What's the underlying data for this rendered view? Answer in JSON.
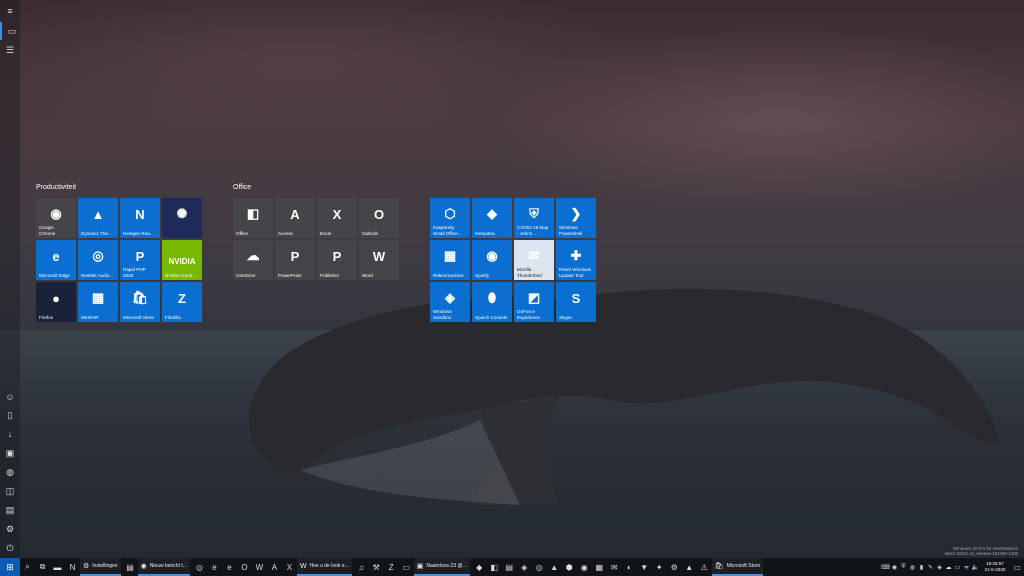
{
  "start_rail": {
    "top": [
      {
        "name": "hamburger-icon",
        "glyph": "≡"
      },
      {
        "name": "tiles-icon",
        "glyph": "▭"
      },
      {
        "name": "all-apps-icon",
        "glyph": "☰"
      }
    ],
    "bottom": [
      {
        "name": "avatar-icon",
        "glyph": "☺"
      },
      {
        "name": "documents-icon",
        "glyph": "▯"
      },
      {
        "name": "downloads-icon",
        "glyph": "↓"
      },
      {
        "name": "pictures-icon",
        "glyph": "▣"
      },
      {
        "name": "network-icon",
        "glyph": "◍"
      },
      {
        "name": "personal-folder-icon",
        "glyph": "◫"
      },
      {
        "name": "explorer-icon",
        "glyph": "▤"
      },
      {
        "name": "settings-icon",
        "glyph": "⚙"
      },
      {
        "name": "power-icon",
        "glyph": "⏻"
      }
    ]
  },
  "groups": [
    {
      "title": "Productiviteit",
      "tiles": [
        {
          "label": "Google\nChrome",
          "glyph": "◉",
          "style": "gray",
          "icon": "chrome-icon"
        },
        {
          "label": "Dynamic The...",
          "glyph": "▲",
          "style": "blue",
          "icon": "dynamic-theme-icon"
        },
        {
          "label": "Nextgen Rea...",
          "glyph": "N",
          "style": "blue",
          "icon": "nextgen-reader-icon"
        },
        {
          "label": "",
          "glyph": "✺",
          "style": "navy",
          "icon": "photo-app-icon"
        },
        {
          "label": "Microsoft Edge",
          "glyph": "e",
          "style": "blue",
          "icon": "edge-icon"
        },
        {
          "label": "Realtek Audio...",
          "glyph": "◎",
          "style": "blue",
          "icon": "realtek-audio-icon"
        },
        {
          "label": "Rapid PHP\n2020",
          "glyph": "P",
          "style": "blue",
          "icon": "rapid-php-icon"
        },
        {
          "label": "NVIDIA Contr...",
          "glyph": "NVIDIA",
          "style": "nv",
          "icon": "nvidia-control-icon"
        },
        {
          "label": "Firefox",
          "glyph": "●",
          "style": "ff",
          "icon": "firefox-icon"
        },
        {
          "label": "WinRAR",
          "glyph": "▦",
          "style": "blue",
          "icon": "winrar-icon"
        },
        {
          "label": "Microsoft Store",
          "glyph": "🛍",
          "style": "blue",
          "icon": "store-icon"
        },
        {
          "label": "FileZilla",
          "glyph": "Z",
          "style": "blue",
          "icon": "filezilla-icon"
        }
      ]
    },
    {
      "title": "Office",
      "tiles": [
        {
          "label": "Office",
          "glyph": "◧",
          "style": "gray",
          "icon": "office-icon"
        },
        {
          "label": "Access",
          "glyph": "A",
          "style": "gray",
          "icon": "access-icon"
        },
        {
          "label": "Excel",
          "glyph": "X",
          "style": "gray",
          "icon": "excel-icon"
        },
        {
          "label": "Outlook",
          "glyph": "O",
          "style": "gray",
          "icon": "outlook-icon"
        },
        {
          "label": "OneDrive",
          "glyph": "☁",
          "style": "gray",
          "icon": "onedrive-icon"
        },
        {
          "label": "PowerPoint",
          "glyph": "P",
          "style": "gray",
          "icon": "powerpoint-icon"
        },
        {
          "label": "Publisher",
          "glyph": "P",
          "style": "gray",
          "icon": "publisher-icon"
        },
        {
          "label": "Word",
          "glyph": "W",
          "style": "gray",
          "icon": "word-icon"
        }
      ]
    },
    {
      "title": "",
      "tiles": [
        {
          "label": "Kaspersky\nSmall Office...",
          "glyph": "⬡",
          "style": "blue",
          "icon": "kaspersky-icon"
        },
        {
          "label": "Klenpatra",
          "glyph": "◆",
          "style": "blue",
          "icon": "kleopatra-icon"
        },
        {
          "label": "COVID-19 Map\n- Johns...",
          "glyph": "⛨",
          "style": "blue",
          "icon": "covid-map-icon"
        },
        {
          "label": "Windows\nPowerShell",
          "glyph": "❯",
          "style": "blue",
          "icon": "powershell-icon"
        },
        {
          "label": "Rekenmachine",
          "glyph": "▦",
          "style": "blue",
          "icon": "calculator-icon"
        },
        {
          "label": "Spotify",
          "glyph": "◉",
          "style": "blue",
          "icon": "spotify-icon"
        },
        {
          "label": "Mozilla\nThunderbird",
          "glyph": "✉",
          "style": "light",
          "icon": "thunderbird-icon"
        },
        {
          "label": "Reset Windows\nUpdate Tool",
          "glyph": "✚",
          "style": "blue",
          "icon": "reset-update-icon"
        },
        {
          "label": "Windows\nSandbox",
          "glyph": "◈",
          "style": "blue",
          "icon": "sandbox-icon"
        },
        {
          "label": "Sputch Console",
          "glyph": "⬮",
          "style": "blue",
          "icon": "sputch-icon"
        },
        {
          "label": "GeForce\nExperience",
          "glyph": "◩",
          "style": "blue",
          "icon": "geforce-icon"
        },
        {
          "label": "Skype",
          "glyph": "S",
          "style": "blue",
          "icon": "skype-icon"
        }
      ]
    }
  ],
  "taskbar": {
    "start_glyph": "⊞",
    "left_icons": [
      {
        "name": "search-icon",
        "glyph": "⌕"
      },
      {
        "name": "task-view-icon",
        "glyph": "⧉"
      },
      {
        "name": "tb-app-icon-1",
        "glyph": "▬"
      },
      {
        "name": "tb-nextgen-icon",
        "glyph": "N"
      }
    ],
    "apps_a": [
      {
        "label": "Instellingen",
        "glyph": "⚙",
        "name": "tb-settings"
      }
    ],
    "mid_icons": [
      {
        "name": "tb-explorer-icon",
        "glyph": "▤"
      }
    ],
    "apps_b": [
      {
        "label": "Nieuw bericht t...",
        "glyph": "◉",
        "name": "tb-chrome-new-message"
      }
    ],
    "icons_b": [
      {
        "name": "tb-chrome-icon",
        "glyph": "◎"
      },
      {
        "name": "tb-edge-icon",
        "glyph": "e"
      },
      {
        "name": "tb-edge2-icon",
        "glyph": "e"
      },
      {
        "name": "tb-outlook-icon",
        "glyph": "O"
      },
      {
        "name": "tb-word-icon",
        "glyph": "W"
      },
      {
        "name": "tb-access-icon",
        "glyph": "A"
      },
      {
        "name": "tb-excel-icon",
        "glyph": "X"
      }
    ],
    "apps_c": [
      {
        "label": "Hoe u de look e...",
        "glyph": "W",
        "name": "tb-word-doc"
      }
    ],
    "icons_c": [
      {
        "name": "tb-mic-icon",
        "glyph": "♫"
      },
      {
        "name": "tb-tool-icon",
        "glyph": "⚒"
      },
      {
        "name": "tb-filezilla-icon",
        "glyph": "Z"
      },
      {
        "name": "tb-terminal-icon",
        "glyph": "▭"
      }
    ],
    "apps_d": [
      {
        "label": "Naamloos-23 @...",
        "glyph": "▣",
        "name": "tb-naamloos"
      }
    ],
    "icons_d": [
      {
        "name": "tb-i1-icon",
        "glyph": "◆"
      },
      {
        "name": "tb-i2-icon",
        "glyph": "◧"
      },
      {
        "name": "tb-i3-icon",
        "glyph": "▤"
      },
      {
        "name": "tb-i4-icon",
        "glyph": "◈"
      },
      {
        "name": "tb-i5-icon",
        "glyph": "◎"
      },
      {
        "name": "tb-i6-icon",
        "glyph": "▲"
      },
      {
        "name": "tb-i7-icon",
        "glyph": "⬢"
      },
      {
        "name": "tb-i8-icon",
        "glyph": "◉"
      },
      {
        "name": "tb-i9-icon",
        "glyph": "▦"
      },
      {
        "name": "tb-i10-icon",
        "glyph": "✉"
      },
      {
        "name": "tb-i11-icon",
        "glyph": "◐"
      },
      {
        "name": "tb-i12-icon",
        "glyph": "▼"
      },
      {
        "name": "tb-i13-icon",
        "glyph": "✦"
      },
      {
        "name": "tb-i14-icon",
        "glyph": "⚙"
      },
      {
        "name": "tb-vlc-icon",
        "glyph": "▲"
      },
      {
        "name": "tb-i15-icon",
        "glyph": "⚠"
      }
    ],
    "apps_e": [
      {
        "label": "Microsoft Store",
        "glyph": "🛍",
        "name": "tb-store"
      }
    ],
    "tray_icons": [
      {
        "name": "tray-1-icon",
        "glyph": "⌨"
      },
      {
        "name": "tray-2-icon",
        "glyph": "◉"
      },
      {
        "name": "tray-3-icon",
        "glyph": "⛨"
      },
      {
        "name": "tray-4-icon",
        "glyph": "◍"
      },
      {
        "name": "tray-5-icon",
        "glyph": "▮"
      },
      {
        "name": "tray-6-icon",
        "glyph": "✎"
      },
      {
        "name": "tray-7-icon",
        "glyph": "◈"
      },
      {
        "name": "tray-8-icon",
        "glyph": "☁"
      },
      {
        "name": "tray-9-icon",
        "glyph": "▭"
      },
      {
        "name": "tray-10-icon",
        "glyph": "ᯤ"
      },
      {
        "name": "tray-volume-icon",
        "glyph": "🔈"
      }
    ],
    "clock_time": "19:25:57",
    "clock_date": "21-5-2020",
    "notification_glyph": "▭"
  },
  "watermark": {
    "line1": "Windows 10 Pro for Workstations",
    "line2": "Build 19041.vb_release.191206-1406"
  }
}
